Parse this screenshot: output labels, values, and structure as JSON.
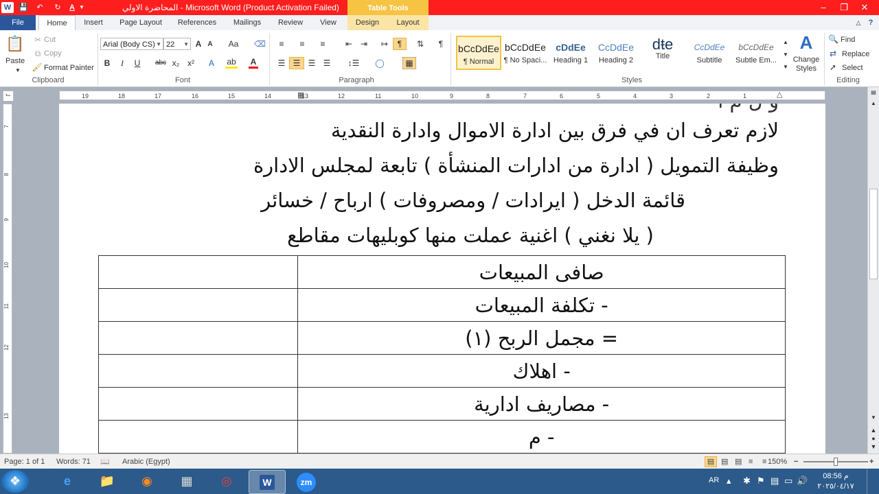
{
  "app": {
    "title": "المحاضرة الاولي  -  Microsoft Word (Product Activation Failed)",
    "contextual_tab_group": "Table Tools"
  },
  "quick_access": {
    "save_icon": "save-icon",
    "undo_icon": "undo-icon",
    "redo_icon": "redo-icon",
    "font_color_letter": "A"
  },
  "window_controls": {
    "minimize": "–",
    "restore": "❐",
    "close": "✕"
  },
  "tabs": [
    "File",
    "Home",
    "Insert",
    "Page Layout",
    "References",
    "Mailings",
    "Review",
    "View",
    "Design",
    "Layout"
  ],
  "ribbon": {
    "clipboard": {
      "label": "Clipboard",
      "paste": "Paste",
      "cut": "Cut",
      "copy": "Copy",
      "format_painter": "Format Painter"
    },
    "font": {
      "label": "Font",
      "font_name": "Arial (Body CS)",
      "font_size": "22",
      "bold": "B",
      "italic": "I",
      "underline": "U",
      "strike": "abc",
      "subscript": "x₂",
      "superscript": "x²",
      "grow": "A",
      "shrink": "A",
      "change_case": "Aa",
      "text_effects": "A",
      "highlight": "ab",
      "color": "A"
    },
    "paragraph": {
      "label": "Paragraph",
      "show_marks": "¶"
    },
    "styles": {
      "label": "Styles",
      "items": [
        {
          "preview": "bCcDdEe",
          "name": "¶ Normal"
        },
        {
          "preview": "bCcDdEe",
          "name": "¶ No Spaci..."
        },
        {
          "preview": "cDdEe",
          "name": "Heading 1"
        },
        {
          "preview": "CcDdEe",
          "name": "Heading 2"
        },
        {
          "preview": "dŧe",
          "name": "Title"
        },
        {
          "preview": "CcDdEe",
          "name": "Subtitle"
        },
        {
          "preview": "bCcDdEe",
          "name": "Subtle Em..."
        }
      ],
      "change_styles": "Change Styles"
    },
    "editing": {
      "label": "Editing",
      "find": "Find",
      "replace": "Replace",
      "select": "Select"
    }
  },
  "ruler": {
    "h_labels": [
      "19",
      "18",
      "17",
      "16",
      "15",
      "14",
      "13",
      "12",
      "11",
      "10",
      "9",
      "8",
      "7",
      "6",
      "5",
      "4",
      "3",
      "2",
      "1"
    ],
    "v_labels": [
      "7",
      "8",
      "9",
      "10",
      "11",
      "12",
      "13"
    ]
  },
  "document": {
    "lines": [
      "لازم تعرف ان في فرق بين ادارة الاموال وادارة النقدية",
      "وظيفة التمويل ( ادارة من  ادارات المنشأة ) تابعة لمجلس الادارة",
      "قائمة الدخل ( ايرادات / ومصروفات ) ارباح / خسائر",
      "( يلا نغني )  اغنية عملت منها كوبليهات مقاطع"
    ],
    "table_rows": [
      "صافى المبيعات",
      "- تكلفة المبيعات",
      "= مجمل الربح (١)",
      "- اهلاك",
      "- مصاريف ادارية",
      "- م"
    ]
  },
  "status": {
    "page": "Page: 1 of 1",
    "words": "Words: 71",
    "language": "Arabic (Egypt)",
    "zoom": "150%",
    "zoom_level": 0.5
  },
  "taskbar": {
    "apps": [
      "start-button",
      "internet-explorer-icon",
      "file-explorer-icon",
      "firefox-icon",
      "calculator-icon",
      "chrome-icon",
      "word-icon",
      "zoom-icon"
    ],
    "word_letter": "W",
    "zoom_text": "zm",
    "lang": "AR",
    "time": "08:56 م",
    "date": "٢٠٢٥/٠٤/١٧"
  },
  "colors": {
    "title_bar": "#ff1e1e",
    "file_tab": "#2b579a",
    "table_tools": "#f6c343",
    "taskbar": "#2c5a8a"
  }
}
